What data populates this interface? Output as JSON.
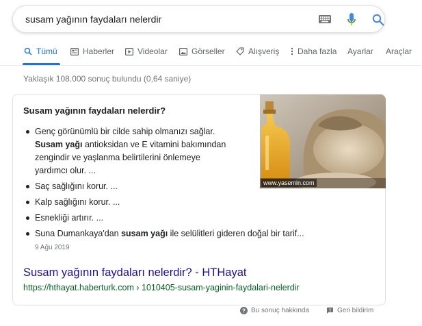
{
  "search": {
    "query": "susam yağının faydaları nelerdir"
  },
  "tabs": [
    {
      "label": "Tümü",
      "icon": "search-icon",
      "active": true
    },
    {
      "label": "Haberler",
      "icon": "news-icon"
    },
    {
      "label": "Videolar",
      "icon": "video-icon"
    },
    {
      "label": "Görseller",
      "icon": "image-icon"
    },
    {
      "label": "Alışveriş",
      "icon": "tag-icon"
    },
    {
      "label": "Daha fazla",
      "icon": "more-vert-icon"
    },
    {
      "label": "Ayarlar"
    },
    {
      "label": "Araçlar"
    }
  ],
  "stats": "Yaklaşık 108.000 sonuç bulundu (0,64 saniye)",
  "snippet": {
    "title": "Susam yağının faydaları nelerdir?",
    "image_caption": "www.yasemin.com",
    "bullets": {
      "b1_pre": "Genç görünümlü bir cilde sahip olmanızı sağlar.",
      "b1_bold": "Susam yağı",
      "b1_post": "antioksidan ve E vitamini bakımından",
      "b1_line3": "zengindir ve yaşlanma belirtilerini önlemeye",
      "b1_line4": "yardımcı olur. ...",
      "b2": "Saç sağlığını korur. ...",
      "b3": "Kalp sağlığını korur. ...",
      "b4": "Esnekliği artırır. ...",
      "b5_pre": "Suna Dumankaya'dan",
      "b5_bold": "susam yağı",
      "b5_post": "ile selülitleri gideren doğal bir tarif..."
    },
    "date": "9 Ağu 2019",
    "link_title": "Susam yağının faydaları nelerdir? - HTHayat",
    "url": "https://hthayat.haberturk.com › 1010405-susam-yaginin-faydalari-nelerdir"
  },
  "footer": {
    "about": "Bu sonuç hakkında",
    "feedback": "Geri bildirim"
  },
  "colors": {
    "accent": "#1a73e8",
    "link": "#1a0dab",
    "url_green": "#006621"
  }
}
